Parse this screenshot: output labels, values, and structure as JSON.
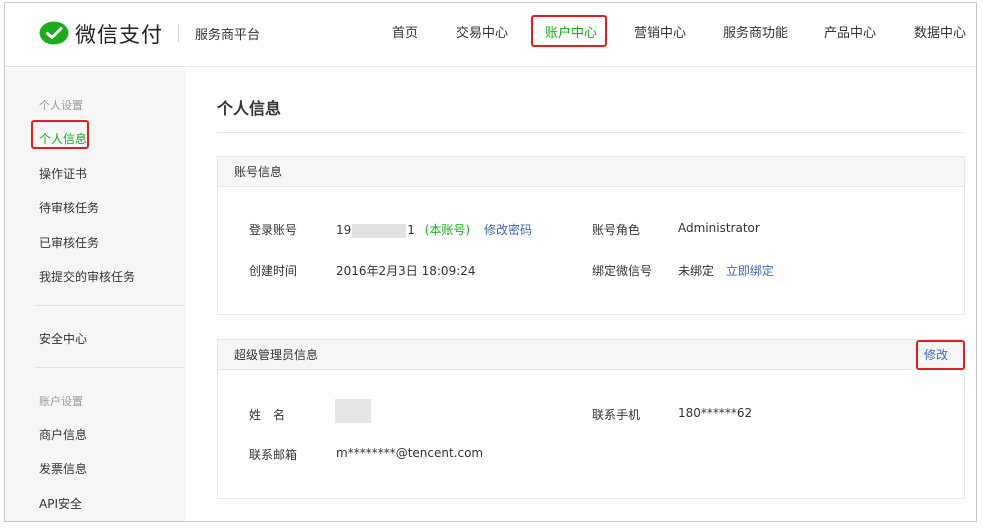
{
  "header": {
    "brand": "微信支付",
    "platform": "服务商平台",
    "nav": [
      "首页",
      "交易中心",
      "账户中心",
      "营销中心",
      "服务商功能",
      "产品中心",
      "数据中心"
    ]
  },
  "sidebar": {
    "group_personal": "个人设置",
    "personal_items": [
      "个人信息",
      "操作证书",
      "待审核任务",
      "已审核任务",
      "我提交的审核任务"
    ],
    "security": "安全中心",
    "group_account": "账户设置",
    "account_items": [
      "商户信息",
      "发票信息",
      "API安全"
    ]
  },
  "main": {
    "title": "个人信息",
    "account_panel": {
      "heading": "账号信息",
      "login_label": "登录账号",
      "login_prefix": "19",
      "login_suffix": "1",
      "this_account": "(本账号)",
      "change_password": "修改密码",
      "role_label": "账号角色",
      "role_value": "Administrator",
      "created_label": "创建时间",
      "created_value": "2016年2月3日 18:09:24",
      "wechat_label": "绑定微信号",
      "wechat_value": "未绑定",
      "bind_now": "立即绑定"
    },
    "admin_panel": {
      "heading": "超级管理员信息",
      "edit": "修改",
      "name_label": "姓　名",
      "phone_label": "联系手机",
      "phone_value": "180******62",
      "email_label": "联系邮箱",
      "email_value": "m********@tencent.com"
    }
  },
  "colors": {
    "brand_green": "#1aad19",
    "link_blue": "#3a6ab5",
    "highlight_red": "#e02020"
  }
}
